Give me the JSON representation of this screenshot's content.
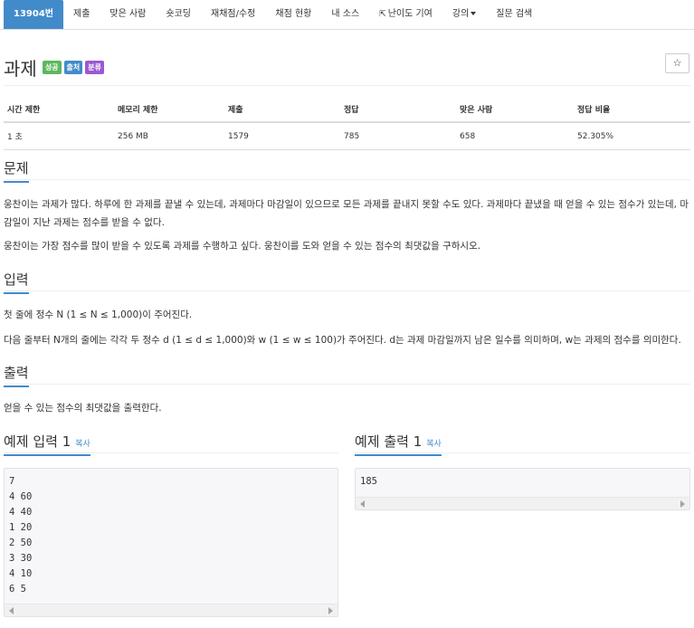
{
  "nav": {
    "items": [
      {
        "label": "13904번"
      },
      {
        "label": "제출"
      },
      {
        "label": "맞은 사람"
      },
      {
        "label": "숏코딩"
      },
      {
        "label": "재채점/수정"
      },
      {
        "label": "채점 현황"
      },
      {
        "label": "내 소스"
      },
      {
        "label": "난이도 기여"
      },
      {
        "label": "강의"
      },
      {
        "label": "질문 검색"
      }
    ]
  },
  "problem": {
    "title": "과제",
    "labels": [
      "성공",
      "출처",
      "분류"
    ],
    "star": "☆"
  },
  "info": {
    "headers": [
      "시간 제한",
      "메모리 제한",
      "제출",
      "정답",
      "맞은 사람",
      "정답 비율"
    ],
    "values": [
      "1 초",
      "256 MB",
      "1579",
      "785",
      "658",
      "52.305%"
    ]
  },
  "sections": {
    "problem_head": "문제",
    "problem_p1": "웅찬이는 과제가 많다. 하루에 한 과제를 끝낼 수 있는데, 과제마다 마감일이 있으므로 모든 과제를 끝내지 못할 수도 있다. 과제마다 끝냈을 때 얻을 수 있는 점수가 있는데, 마감일이 지난 과제는 점수를 받을 수 없다.",
    "problem_p2": "웅찬이는 가장 점수를 많이 받을 수 있도록 과제를 수행하고 싶다. 웅찬이를 도와 얻을 수 있는 점수의 최댓값을 구하시오.",
    "input_head": "입력",
    "input_p1": "첫 줄에 정수 N (1 ≤ N ≤ 1,000)이 주어진다.",
    "input_p2": "다음 줄부터 N개의 줄에는 각각 두 정수 d (1 ≤ d ≤ 1,000)와 w (1 ≤ w ≤ 100)가 주어진다. d는 과제 마감일까지 남은 일수를 의미하며, w는 과제의 점수를 의미한다.",
    "output_head": "출력",
    "output_p1": "얻을 수 있는 점수의 최댓값을 출력한다."
  },
  "samples": {
    "input_head": "예제 입력 1",
    "output_head": "예제 출력 1",
    "copy": "복사",
    "input_text": "7\n4 60\n4 40\n1 20\n2 50\n3 30\n4 10\n6 5",
    "output_text": "185"
  }
}
